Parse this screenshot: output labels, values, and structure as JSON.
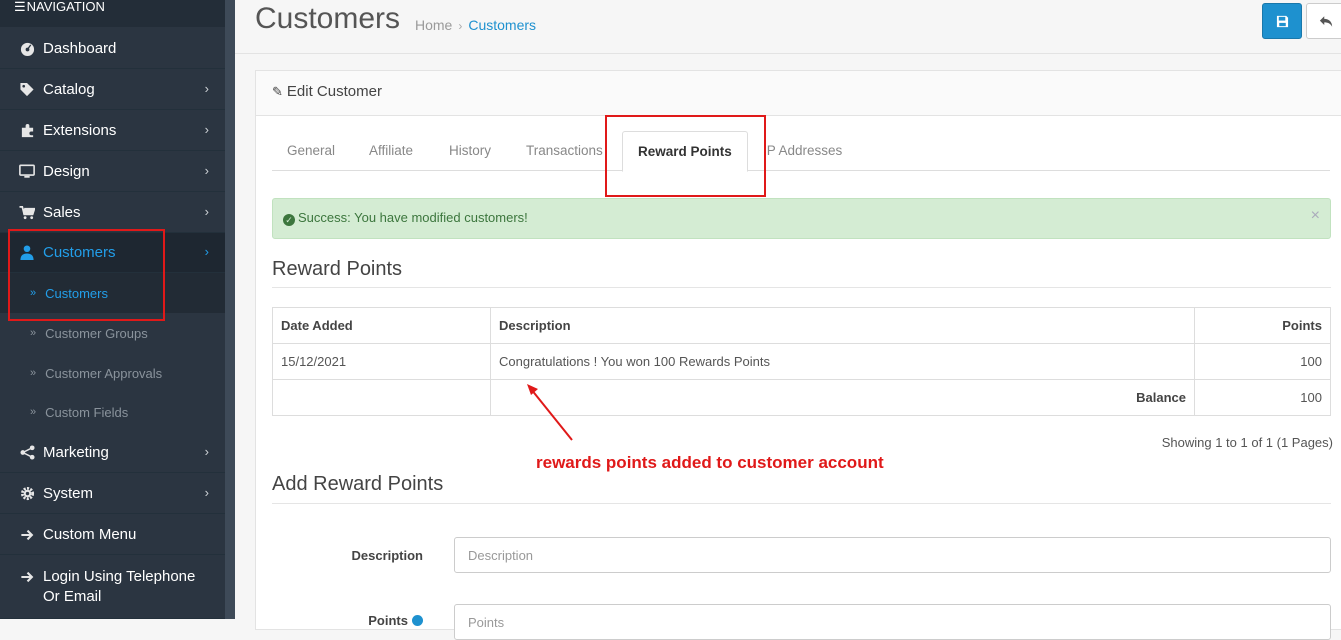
{
  "sidebar": {
    "heading": "NAVIGATION",
    "items": [
      {
        "label": "Dashboard",
        "icon": "dashboard-icon"
      },
      {
        "label": "Catalog",
        "icon": "tags-icon"
      },
      {
        "label": "Extensions",
        "icon": "puzzle-icon"
      },
      {
        "label": "Design",
        "icon": "desktop-icon"
      },
      {
        "label": "Sales",
        "icon": "cart-icon"
      },
      {
        "label": "Customers",
        "icon": "user-icon"
      },
      {
        "label": "Marketing",
        "icon": "share-icon"
      },
      {
        "label": "System",
        "icon": "cog-icon"
      },
      {
        "label": "Custom Menu",
        "icon": "arrow-right-icon"
      },
      {
        "label": "Login Using Telephone Or Email",
        "icon": "arrow-right-icon"
      }
    ],
    "customers_sub": [
      "Customers",
      "Customer Groups",
      "Customer Approvals",
      "Custom Fields"
    ]
  },
  "header": {
    "title": "Customers",
    "breadcrumb": [
      "Home",
      "Customers"
    ]
  },
  "panel": {
    "title": "Edit Customer",
    "tabs": [
      "General",
      "Affiliate",
      "History",
      "Transactions",
      "Reward Points",
      "IP Addresses"
    ],
    "active_tab": "Reward Points"
  },
  "alert": {
    "text": "Success: You have modified customers!",
    "close": "×"
  },
  "reward_points": {
    "title": "Reward Points",
    "columns": [
      "Date Added",
      "Description",
      "Points"
    ],
    "rows": [
      {
        "date": "15/12/2021",
        "description": "Congratulations ! You won 100 Rewards Points",
        "points": "100"
      }
    ],
    "balance_label": "Balance",
    "balance_value": "100",
    "pagination": "Showing 1 to 1 of 1 (1 Pages)"
  },
  "annotation": {
    "text": "rewards points added to customer account"
  },
  "add_reward": {
    "title": "Add Reward Points",
    "description_label": "Description",
    "description_placeholder": "Description",
    "points_label": "Points",
    "points_placeholder": "Points"
  },
  "colors": {
    "sidebar_bg": "#2b3541",
    "accent": "#1e91cf",
    "highlight": "#e01919",
    "success_bg": "#d4ecd3"
  }
}
